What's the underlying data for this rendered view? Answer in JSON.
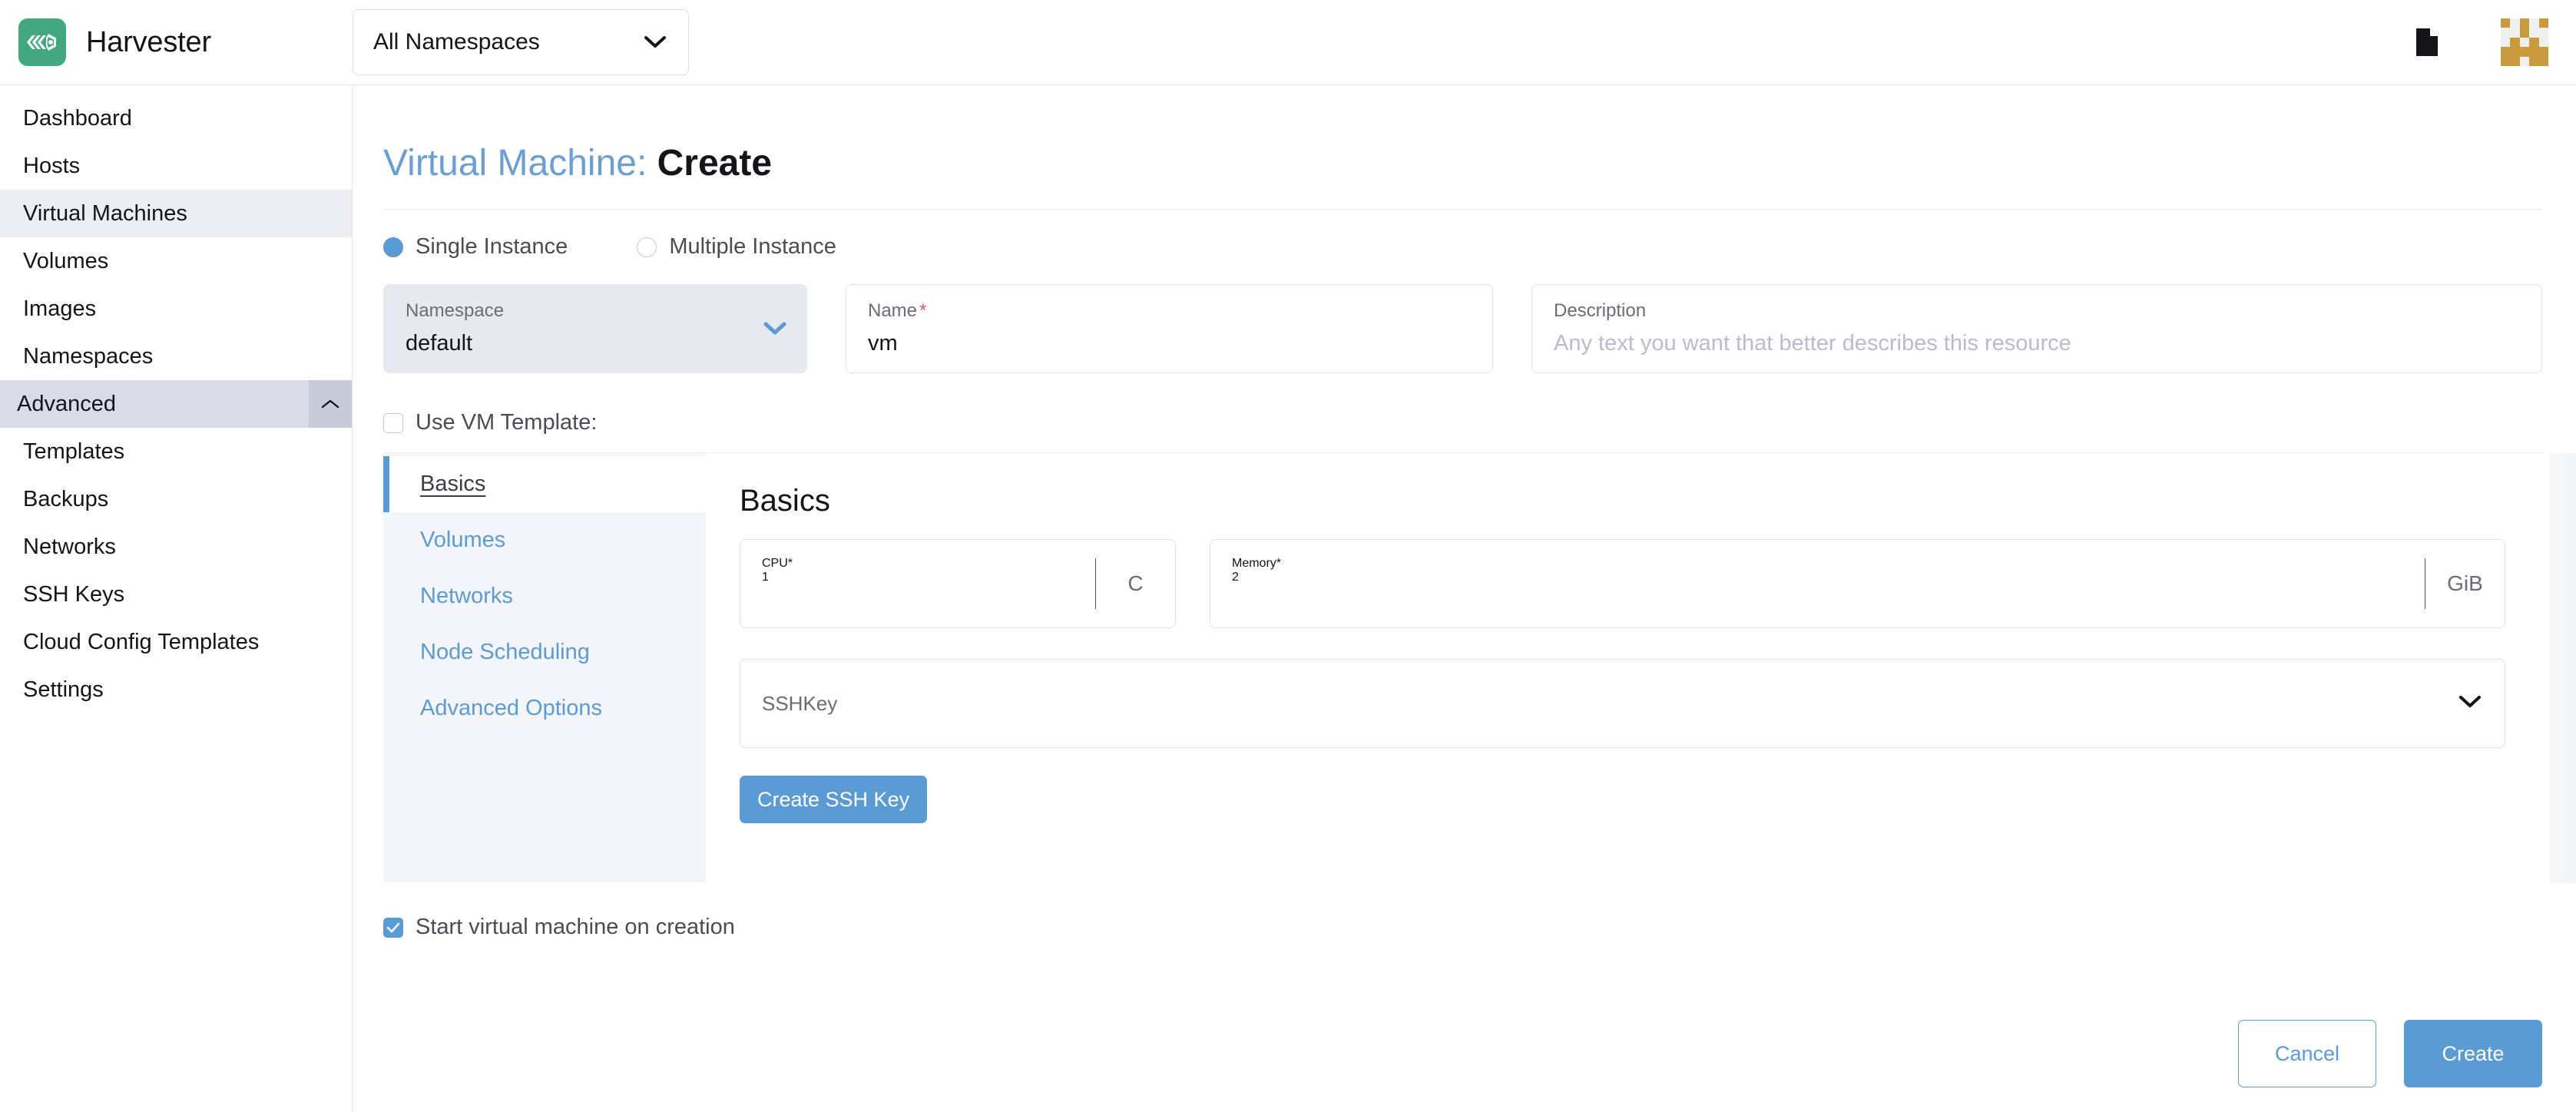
{
  "header": {
    "brand_name": "Harvester",
    "logo_icon": "harvester-logo-icon",
    "namespace_filter": {
      "value": "All Namespaces",
      "chevron_icon": "chevron-down-icon"
    },
    "doc_icon": "document-icon",
    "avatar_icon": "user-avatar-identicon",
    "avatar_color": "#ca9a3f"
  },
  "sidebar": {
    "items": [
      {
        "label": "Dashboard",
        "type": "link",
        "active": false
      },
      {
        "label": "Hosts",
        "type": "link",
        "active": false
      },
      {
        "label": "Virtual Machines",
        "type": "link",
        "active": true
      },
      {
        "label": "Volumes",
        "type": "link",
        "active": false
      },
      {
        "label": "Images",
        "type": "link",
        "active": false
      },
      {
        "label": "Namespaces",
        "type": "link",
        "active": false
      },
      {
        "label": "Advanced",
        "type": "group",
        "expanded": true,
        "caret_icon": "chevron-up-icon"
      },
      {
        "label": "Templates",
        "type": "child",
        "active": false
      },
      {
        "label": "Backups",
        "type": "child",
        "active": false
      },
      {
        "label": "Networks",
        "type": "child",
        "active": false
      },
      {
        "label": "SSH Keys",
        "type": "child",
        "active": false
      },
      {
        "label": "Cloud Config Templates",
        "type": "child",
        "active": false
      },
      {
        "label": "Settings",
        "type": "child",
        "active": false
      }
    ]
  },
  "main": {
    "title_resource": "Virtual Machine:",
    "title_action": "Create",
    "instance_mode": {
      "options": [
        {
          "label": "Single Instance",
          "selected": true
        },
        {
          "label": "Multiple Instance",
          "selected": false
        }
      ]
    },
    "namespace_field": {
      "label": "Namespace",
      "value": "default",
      "chevron_icon": "chevron-down-icon"
    },
    "name_field": {
      "label": "Name",
      "required_marker": "*",
      "value": "vm"
    },
    "description_field": {
      "label": "Description",
      "value": "",
      "placeholder": "Any text you want that better describes this resource"
    },
    "use_vm_template": {
      "label": "Use VM Template:",
      "checked": false
    },
    "tabs": [
      {
        "label": "Basics",
        "active": true
      },
      {
        "label": "Volumes",
        "active": false
      },
      {
        "label": "Networks",
        "active": false
      },
      {
        "label": "Node Scheduling",
        "active": false
      },
      {
        "label": "Advanced Options",
        "active": false
      }
    ],
    "basics": {
      "heading": "Basics",
      "cpu": {
        "label": "CPU",
        "required_marker": "*",
        "value": "1",
        "unit": "C"
      },
      "memory": {
        "label": "Memory",
        "required_marker": "*",
        "value": "2",
        "unit": "GiB"
      },
      "sshkey": {
        "label": "SSHKey",
        "value": "",
        "chevron_icon": "chevron-down-icon"
      },
      "create_ssh_key_button": "Create SSH Key"
    },
    "start_on_creation": {
      "label": "Start virtual machine on creation",
      "checked": true
    },
    "footer": {
      "cancel_label": "Cancel",
      "create_label": "Create"
    }
  },
  "colors": {
    "brand_green": "#43a882",
    "accent_blue": "#5b9bd5",
    "link_blue": "#6b9fd4",
    "required_red": "#e05c5c",
    "avatar_gold": "#ca9a3f"
  }
}
